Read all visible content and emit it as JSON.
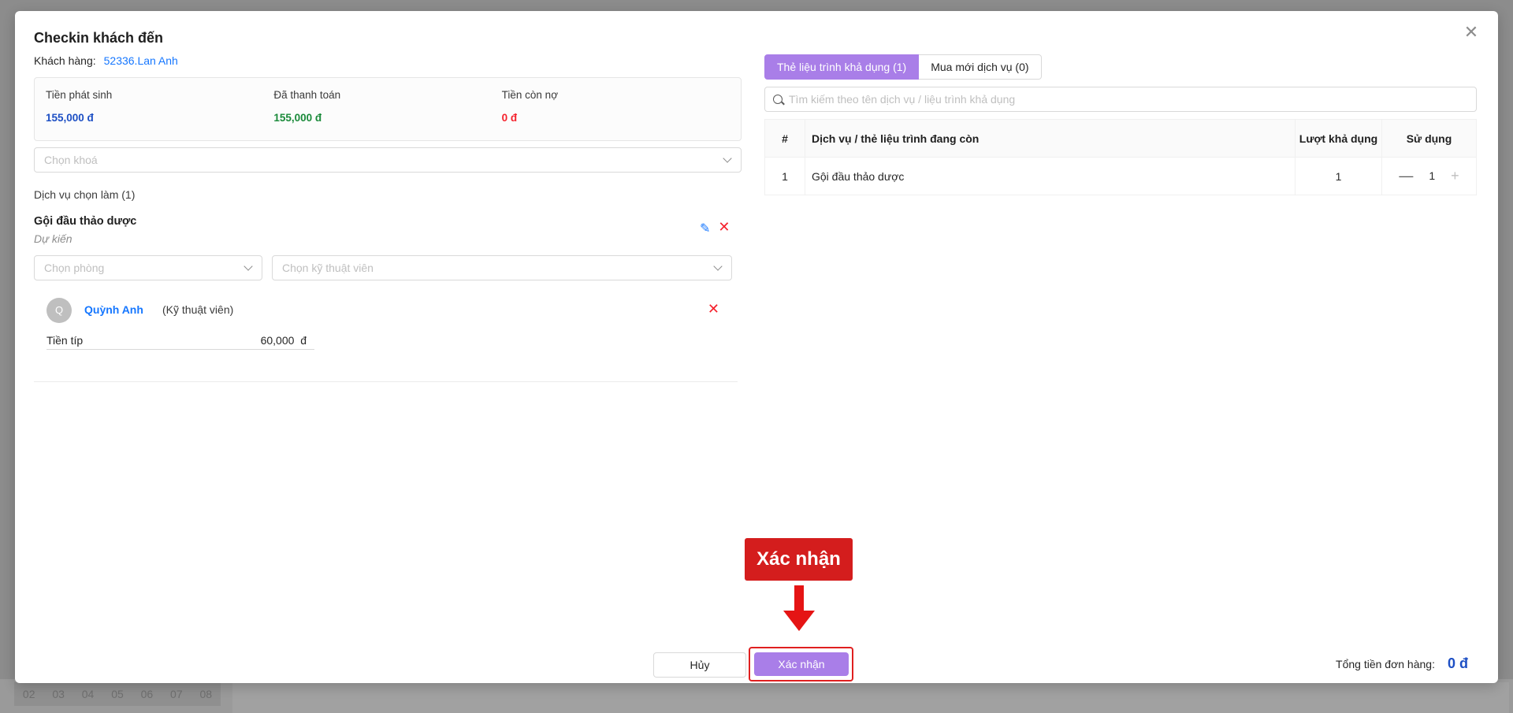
{
  "modal": {
    "title": "Checkin khách đến",
    "customer_label": "Khách hàng:",
    "customer_value": "52336.Lan Anh"
  },
  "summary": [
    {
      "label": "Tiền phát sinh",
      "value": "155,000 đ",
      "color": "#1d4fc4"
    },
    {
      "label": "Đã thanh toán",
      "value": "155,000 đ",
      "color": "#1a8a3a"
    },
    {
      "label": "Tiền còn nợ",
      "value": "0 đ",
      "color": "#f5222d"
    }
  ],
  "khoa_placeholder": "Chọn khoá",
  "service": {
    "header": "Dịch vụ chọn làm (1)",
    "name": "Gội đầu thảo dược",
    "status": "Dự kiến",
    "room_placeholder": "Chọn phòng",
    "tech_placeholder": "Chọn kỹ thuật viên",
    "tech": {
      "initial": "Q",
      "name": "Quỳnh Anh",
      "role": "(Kỹ thuật viên)",
      "tip_label": "Tiền típ",
      "tip_amount": "60,000",
      "tip_currency": "đ"
    }
  },
  "tabs": [
    {
      "label": "Thẻ liệu trình khả dụng (1)",
      "active": true
    },
    {
      "label": "Mua mới dịch vụ (0)",
      "active": false
    }
  ],
  "search_placeholder": "Tìm kiếm theo tên dịch vụ / liệu trình khả dụng",
  "table": {
    "headers": [
      "#",
      "Dịch vụ / thẻ liệu trình đang còn",
      "Lượt khả dụng",
      "Sử dụng"
    ],
    "rows": [
      {
        "index": "1",
        "name": "Gội đầu thảo dược",
        "available": "1",
        "use": "1"
      }
    ]
  },
  "footer": {
    "cancel": "Hủy",
    "confirm": "Xác nhận",
    "total_label": "Tổng tiền đơn hàng:",
    "total_value": "0 đ"
  },
  "annotation": "Xác nhận",
  "background_days": [
    "02",
    "03",
    "04",
    "05",
    "06",
    "07",
    "08"
  ],
  "colors": {
    "accent": "#a97ee8",
    "highlight": "#e02020",
    "link": "#1677ff"
  }
}
